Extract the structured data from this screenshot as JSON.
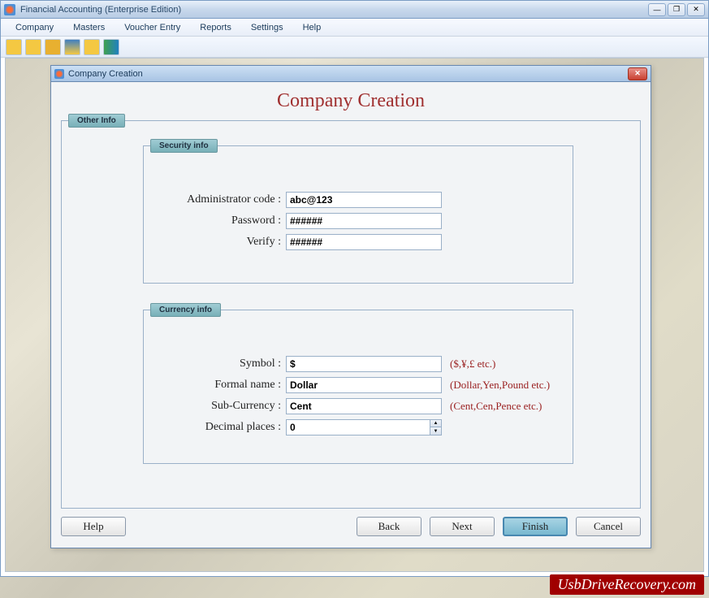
{
  "app": {
    "title": "Financial Accounting (Enterprise Edition)",
    "menu": [
      "Company",
      "Masters",
      "Voucher Entry",
      "Reports",
      "Settings",
      "Help"
    ]
  },
  "dialog": {
    "title": "Company Creation",
    "heading": "Company Creation",
    "tab": "Other Info",
    "security": {
      "legend": "Security info",
      "admin_label": "Administrator code :",
      "admin_value": "abc@123",
      "password_label": "Password :",
      "password_value": "######",
      "verify_label": "Verify :",
      "verify_value": "######"
    },
    "currency": {
      "legend": "Currency info",
      "symbol_label": "Symbol :",
      "symbol_value": "$",
      "symbol_hint": "($,¥,£ etc.)",
      "formal_label": "Formal name :",
      "formal_value": "Dollar",
      "formal_hint": "(Dollar,Yen,Pound etc.)",
      "sub_label": "Sub-Currency :",
      "sub_value": "Cent",
      "sub_hint": "(Cent,Cen,Pence etc.)",
      "decimal_label": "Decimal places :",
      "decimal_value": "0"
    },
    "buttons": {
      "help": "Help",
      "back": "Back",
      "next": "Next",
      "finish": "Finish",
      "cancel": "Cancel"
    }
  },
  "watermark": "UsbDriveRecovery.com"
}
